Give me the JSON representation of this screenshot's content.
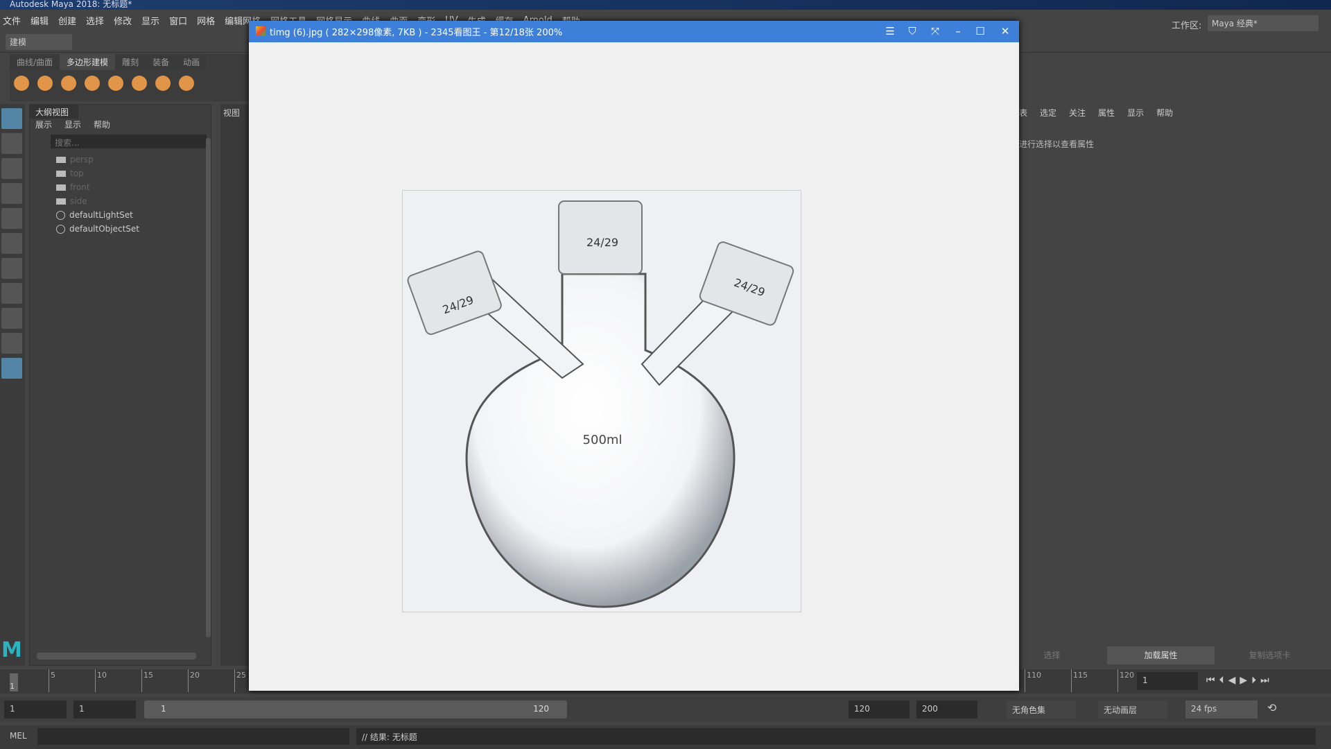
{
  "window_title": "Autodesk Maya 2018: 无标题*",
  "menu": [
    "文件",
    "编辑",
    "创建",
    "选择",
    "修改",
    "显示",
    "窗口",
    "网格",
    "编辑网格",
    "网格工具",
    "网格显示",
    "曲线",
    "曲面",
    "变形",
    "UV",
    "生成",
    "缓存",
    "Arnold",
    "帮助"
  ],
  "toolbar": {
    "mode": "建模",
    "workspace_label": "工作区:",
    "workspace": "Maya 经典*"
  },
  "shelf_tabs": [
    "曲线/曲面",
    "多边形建模",
    "雕刻",
    "装备",
    "动画"
  ],
  "outliner": {
    "title": "大纲视图",
    "menu": [
      "展示",
      "显示",
      "帮助"
    ],
    "search_placeholder": "搜索...",
    "items": [
      {
        "label": "persp",
        "type": "camera"
      },
      {
        "label": "top",
        "type": "camera"
      },
      {
        "label": "front",
        "type": "camera"
      },
      {
        "label": "side",
        "type": "camera"
      },
      {
        "label": "defaultLightSet",
        "type": "set"
      },
      {
        "label": "defaultObjectSet",
        "type": "set"
      }
    ]
  },
  "viewport": {
    "title": "视图"
  },
  "attribute_editor": {
    "menu": [
      "表",
      "选定",
      "关注",
      "属性",
      "显示",
      "帮助"
    ],
    "hint": "进行选择以查看属性",
    "tabs": [
      "选择",
      "加载属性",
      "复制选项卡"
    ]
  },
  "viewer": {
    "title": "timg (6).jpg ( 282×298像素, 7KB ) - 2345看图王 - 第12/18张 200%",
    "controls": [
      "menu-icon",
      "skin-icon",
      "fullscreen-icon",
      "minimize-icon",
      "maximize-icon",
      "close-icon"
    ],
    "photo": {
      "joint_label": "24/29",
      "volume_label": "500ml"
    }
  },
  "timeline": {
    "ticks_left": [
      "5",
      "10",
      "15",
      "20",
      "25"
    ],
    "ticks_right": [
      "110",
      "115",
      "120"
    ],
    "current_frame": "1",
    "current_frame_field": "1"
  },
  "range": {
    "start": "1",
    "playback_start": "1",
    "slider_start": "1",
    "slider_end": "120",
    "playback_end": "120",
    "end": "200",
    "character_set": "无角色集",
    "anim_layer": "无动画层",
    "fps": "24 fps"
  },
  "command": {
    "lang": "MEL",
    "result": "// 结果: 无标题"
  },
  "colors": {
    "accent": "#3d7fd9",
    "shelf_icon": "#e09447",
    "selected_tool": "#5285a6"
  }
}
